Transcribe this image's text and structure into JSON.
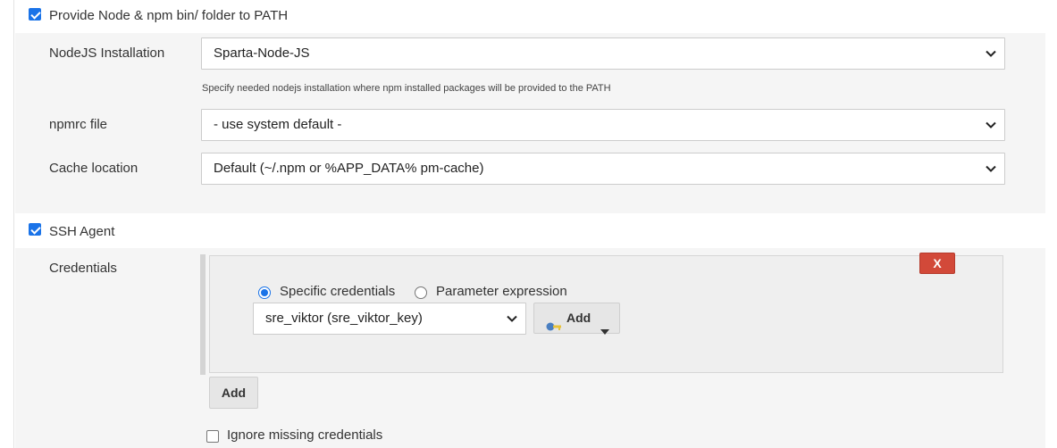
{
  "nodejs_section": {
    "checkbox_label": "Provide Node & npm bin/ folder to PATH",
    "checked": true,
    "installation": {
      "label": "NodeJS Installation",
      "value": "Sparta-Node-JS",
      "hint": "Specify needed nodejs installation where npm installed packages will be provided to the PATH"
    },
    "npmrc": {
      "label": "npmrc file",
      "value": "- use system default -"
    },
    "cache": {
      "label": "Cache location",
      "value": "Default (~/.npm or %APP_DATA% pm-cache)"
    }
  },
  "ssh_section": {
    "checkbox_label": "SSH Agent",
    "checked": true,
    "credentials": {
      "label": "Credentials",
      "delete_label": "X",
      "radio_specific": "Specific credentials",
      "radio_parameter": "Parameter expression",
      "selected_radio": "specific",
      "select_value": "sre_viktor (sre_viktor_key)",
      "add_dropdown_label": "Add",
      "add_button_label": "Add"
    },
    "ignore_missing": {
      "label": "Ignore missing credentials",
      "checked": false
    }
  },
  "icons": {
    "chevron": "chevron-down-icon",
    "key": "key-icon",
    "caret": "caret-down-icon"
  },
  "colors": {
    "accent": "#1a73e8",
    "danger": "#d24939",
    "section_bg": "#f5f5f5"
  }
}
